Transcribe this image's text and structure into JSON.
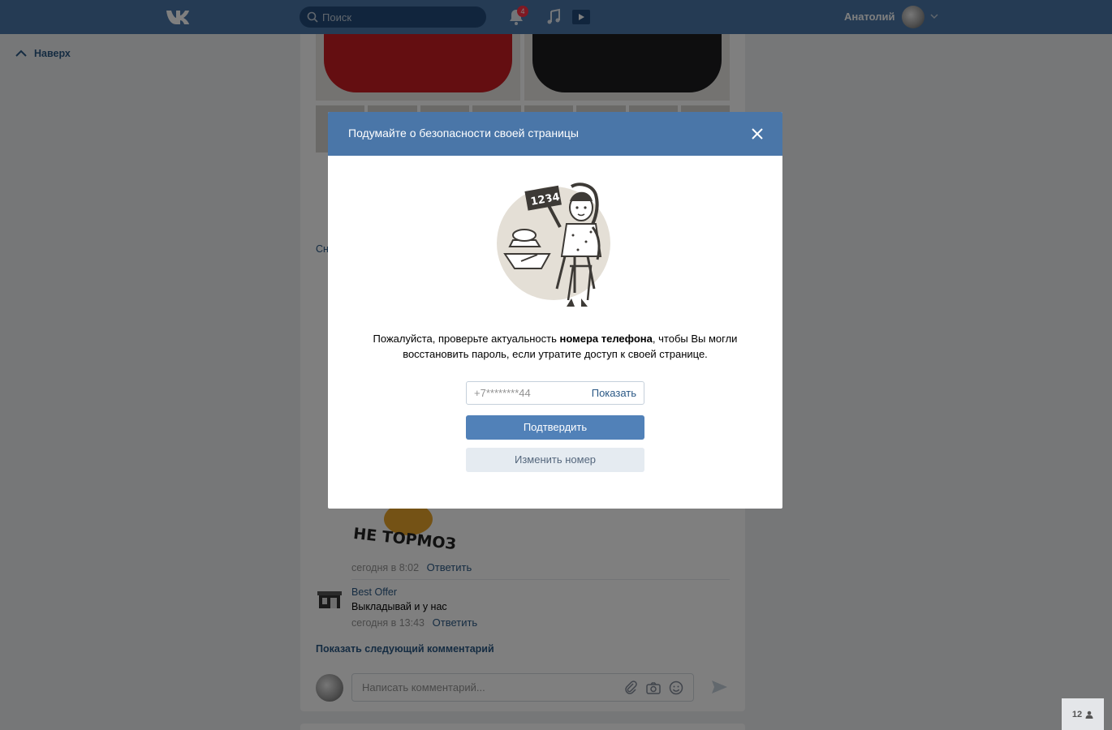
{
  "header": {
    "search_placeholder": "Поиск",
    "notifications_count": "4",
    "user_name": "Анатолий"
  },
  "left": {
    "scroll_up_label": "Наверх"
  },
  "feed": {
    "snippet_link": "Сн",
    "comment1": {
      "sticker_text": "НЕ ТОРМОЗИ!",
      "time": "сегодня в 8:02",
      "reply": "Ответить"
    },
    "comment2": {
      "author": "Best Offer",
      "text": "Выкладывай и у нас",
      "time": "сегодня в 13:43",
      "reply": "Ответить"
    },
    "show_next": "Показать следующий комментарий",
    "comment_placeholder": "Написать комментарий..."
  },
  "online_counter": "12",
  "modal": {
    "title": "Подумайте о безопасности своей страницы",
    "illustration_sign": "1234",
    "message_before": "Пожалуйста, проверьте актуальность ",
    "message_bold": "номера телефона",
    "message_after": ", чтобы Вы могли восстановить пароль, если утратите доступ к своей странице.",
    "phone_value": "+7********44",
    "show_label": "Показать",
    "confirm_label": "Подтвердить",
    "change_label": "Изменить номер"
  },
  "colors": {
    "header_bg": "#4a76a8",
    "primary_button": "#5181b8",
    "secondary_button": "#e5ebf1",
    "link": "#2a5885",
    "page_bg": "#edeef0"
  }
}
